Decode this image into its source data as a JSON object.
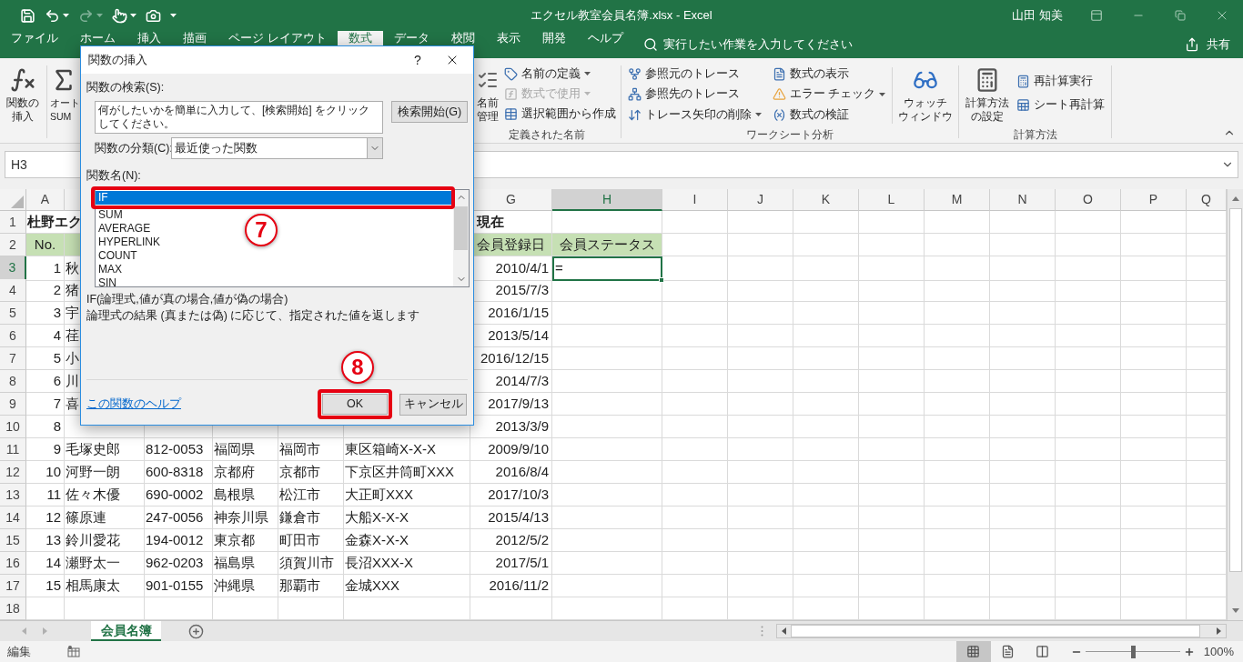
{
  "window": {
    "title": "エクセル教室会員名簿.xlsx  -  Excel",
    "user": "山田 知美"
  },
  "quick_access": [
    {
      "kind": "save",
      "dropdown": false,
      "disabled": false
    },
    {
      "kind": "undo",
      "dropdown": true,
      "disabled": false
    },
    {
      "kind": "redo",
      "dropdown": true,
      "disabled": true
    },
    {
      "kind": "touch",
      "dropdown": true,
      "disabled": false
    },
    {
      "kind": "camera",
      "dropdown": false,
      "disabled": false
    },
    {
      "kind": "customize",
      "dropdown": false,
      "disabled": false
    }
  ],
  "ribbon_tabs": [
    {
      "label": "ファイル",
      "selected": false
    },
    {
      "label": "ホーム",
      "selected": false
    },
    {
      "label": "挿入",
      "selected": false
    },
    {
      "label": "描画",
      "selected": false
    },
    {
      "label": "ページ レイアウト",
      "selected": false
    },
    {
      "label": "数式",
      "selected": true
    },
    {
      "label": "データ",
      "selected": false
    },
    {
      "label": "校閲",
      "selected": false
    },
    {
      "label": "表示",
      "selected": false
    },
    {
      "label": "開発",
      "selected": false
    },
    {
      "label": "ヘルプ",
      "selected": false
    }
  ],
  "tell_me": "実行したい作業を入力してください",
  "share": "共有",
  "ribbon": {
    "insert_function": [
      "関数の",
      "挿入"
    ],
    "autosum": [
      "オート",
      "SUM"
    ],
    "defined_names": {
      "label": "定義された名前",
      "manager": [
        "名前",
        "管理"
      ],
      "commands": [
        {
          "kind": "define",
          "label": "名前の定義",
          "dropdown": true,
          "disabled": false
        },
        {
          "kind": "use",
          "label": "数式で使用",
          "dropdown": true,
          "disabled": true
        },
        {
          "kind": "create",
          "label": "選択範囲から作成",
          "dropdown": false,
          "disabled": false
        }
      ]
    },
    "auditing": {
      "label": "ワークシート分析",
      "commands": [
        {
          "kind": "precedents",
          "label": "参照元のトレース",
          "dropdown": false,
          "disabled": false
        },
        {
          "kind": "dependents",
          "label": "参照先のトレース",
          "dropdown": false,
          "disabled": false
        },
        {
          "kind": "remove-arrows",
          "label": "トレース矢印の削除",
          "dropdown": true,
          "disabled": false
        },
        {
          "kind": "show-formulas",
          "label": "数式の表示",
          "dropdown": false,
          "disabled": false
        },
        {
          "kind": "error-check",
          "label": "エラー チェック",
          "dropdown": true,
          "disabled": false
        },
        {
          "kind": "evaluate",
          "label": "数式の検証",
          "dropdown": false,
          "disabled": false
        }
      ],
      "watch": [
        "ウォッチ",
        "ウィンドウ"
      ]
    },
    "calculation": {
      "label": "計算方法",
      "options": [
        "計算方法",
        "の設定"
      ],
      "commands": [
        {
          "kind": "calc-now",
          "label": "再計算実行",
          "dropdown": false,
          "disabled": false
        },
        {
          "kind": "calc-sheet",
          "label": "シート再計算",
          "dropdown": false,
          "disabled": false
        }
      ]
    }
  },
  "formula_bar": {
    "name_box": "H3"
  },
  "sheet": {
    "columns": [
      {
        "label": "A",
        "selected": false
      },
      null,
      null,
      null,
      null,
      null,
      {
        "label": "G",
        "selected": false
      },
      {
        "label": "H",
        "selected": true
      },
      {
        "label": "I",
        "selected": false
      },
      {
        "label": "J",
        "selected": false
      },
      {
        "label": "K",
        "selected": false
      },
      {
        "label": "L",
        "selected": false
      },
      {
        "label": "M",
        "selected": false
      },
      {
        "label": "N",
        "selected": false
      },
      {
        "label": "O",
        "selected": false
      },
      {
        "label": "P",
        "selected": false
      },
      {
        "label": "Q",
        "selected": false
      }
    ],
    "rows": [
      {
        "number": "1",
        "kind": "title",
        "selected": false,
        "cells": [
          "杜野エク",
          null,
          null,
          null,
          null,
          null,
          "現在"
        ]
      },
      {
        "number": "2",
        "kind": "header",
        "selected": false,
        "cells": [
          "No.",
          null,
          null,
          null,
          null,
          null,
          "会員登録日",
          "会員ステータス"
        ]
      },
      {
        "number": "3",
        "kind": "record",
        "selected": true,
        "cells": [
          "1",
          "秋",
          null,
          null,
          null,
          null,
          "2010/4/1",
          "="
        ]
      },
      {
        "number": "4",
        "kind": "record",
        "selected": false,
        "cells": [
          "2",
          "猪",
          null,
          null,
          null,
          null,
          "2015/7/3"
        ]
      },
      {
        "number": "5",
        "kind": "record",
        "selected": false,
        "cells": [
          "3",
          "宇",
          null,
          null,
          null,
          null,
          "2016/1/15"
        ]
      },
      {
        "number": "6",
        "kind": "record",
        "selected": false,
        "cells": [
          "4",
          "荏",
          null,
          null,
          null,
          null,
          "2013/5/14"
        ]
      },
      {
        "number": "7",
        "kind": "record",
        "selected": false,
        "cells": [
          "5",
          "小",
          null,
          null,
          null,
          null,
          "2016/12/15"
        ]
      },
      {
        "number": "8",
        "kind": "record",
        "selected": false,
        "cells": [
          "6",
          "川",
          null,
          null,
          null,
          null,
          "2014/7/3"
        ]
      },
      {
        "number": "9",
        "kind": "record",
        "selected": false,
        "cells": [
          "7",
          "喜",
          null,
          null,
          null,
          null,
          "2017/9/13"
        ]
      },
      {
        "number": "10",
        "kind": "record",
        "selected": false,
        "cells": [
          "8",
          null,
          null,
          null,
          null,
          null,
          "2013/3/9"
        ]
      },
      {
        "number": "11",
        "kind": "record",
        "selected": false,
        "cells": [
          "9",
          "毛塚史郎",
          "812-0053",
          "福岡県",
          "福岡市",
          "東区箱崎X-X-X",
          "2009/9/10"
        ]
      },
      {
        "number": "12",
        "kind": "record",
        "selected": false,
        "cells": [
          "10",
          "河野一朗",
          "600-8318",
          "京都府",
          "京都市",
          "下京区井筒町XXX",
          "2016/8/4"
        ]
      },
      {
        "number": "13",
        "kind": "record",
        "selected": false,
        "cells": [
          "11",
          "佐々木優",
          "690-0002",
          "島根県",
          "松江市",
          "大正町XXX",
          "2017/10/3"
        ]
      },
      {
        "number": "14",
        "kind": "record",
        "selected": false,
        "cells": [
          "12",
          "篠原連",
          "247-0056",
          "神奈川県",
          "鎌倉市",
          "大船X-X-X",
          "2015/4/13"
        ]
      },
      {
        "number": "15",
        "kind": "record",
        "selected": false,
        "cells": [
          "13",
          "鈴川愛花",
          "194-0012",
          "東京都",
          "町田市",
          "金森X-X-X",
          "2012/5/2"
        ]
      },
      {
        "number": "16",
        "kind": "record",
        "selected": false,
        "cells": [
          "14",
          "瀬野太一",
          "962-0203",
          "福島県",
          "須賀川市",
          "長沼XXX-X",
          "2017/5/1"
        ]
      },
      {
        "number": "17",
        "kind": "record",
        "selected": false,
        "cells": [
          "15",
          "相馬康太",
          "901-0155",
          "沖縄県",
          "那覇市",
          "金城XXX",
          "2016/11/2"
        ]
      },
      {
        "number": "18",
        "kind": "record",
        "selected": false
      }
    ]
  },
  "sheet_tabs": [
    {
      "label": "会員名簿",
      "selected": true
    }
  ],
  "status_bar": {
    "mode": "編集",
    "views": [
      {
        "kind": "normal",
        "selected": true
      },
      {
        "kind": "page-layout",
        "selected": false
      },
      {
        "kind": "page-break",
        "selected": false
      }
    ],
    "zoom": {
      "level": 0.5,
      "reading": "100%"
    }
  },
  "dialog": {
    "title": "関数の挿入",
    "help": "?",
    "search_label": "関数の検索(S):",
    "search_value": "何がしたいかを簡単に入力して、[検索開始] をクリックしてください。",
    "search_button": "検索開始(G)",
    "category_label": "関数の分類(C):",
    "category_value": "最近使った関数",
    "list_label": "関数名(N):",
    "functions": [
      {
        "name": "IF",
        "selected": true,
        "highlighted": true
      },
      {
        "name": "SUM",
        "selected": false,
        "highlighted": false
      },
      {
        "name": "AVERAGE",
        "selected": false,
        "highlighted": false
      },
      {
        "name": "HYPERLINK",
        "selected": false,
        "highlighted": false
      },
      {
        "name": "COUNT",
        "selected": false,
        "highlighted": false
      },
      {
        "name": "MAX",
        "selected": false,
        "highlighted": false
      },
      {
        "name": "SIN",
        "selected": false,
        "highlighted": false
      }
    ],
    "syntax": "IF(論理式,値が真の場合,値が偽の場合)",
    "description": "論理式の結果 (真または偽) に応じて、指定された値を返します",
    "help_link": "この関数のヘルプ",
    "ok": "OK",
    "ok_highlighted": true,
    "cancel": "キャンセル"
  },
  "step_markers": [
    {
      "label": "7"
    },
    {
      "label": "8"
    }
  ]
}
